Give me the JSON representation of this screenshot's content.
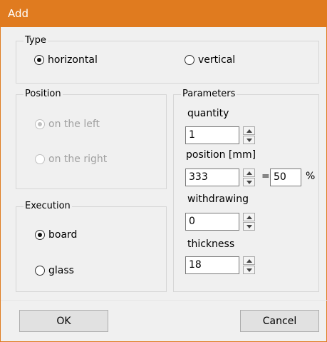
{
  "window": {
    "title": "Add"
  },
  "type_group": {
    "legend": "Type",
    "options": [
      {
        "label": "horizontal",
        "checked": true
      },
      {
        "label": "vertical",
        "checked": false
      }
    ]
  },
  "position_group": {
    "legend": "Position",
    "options": [
      {
        "label": "on the left",
        "checked": true,
        "disabled": true
      },
      {
        "label": "on the right",
        "checked": false,
        "disabled": true
      }
    ]
  },
  "execution_group": {
    "legend": "Execution",
    "options": [
      {
        "label": "board",
        "checked": true
      },
      {
        "label": "glass",
        "checked": false
      }
    ]
  },
  "parameters": {
    "legend": "Parameters",
    "quantity": {
      "label": "quantity",
      "value": "1"
    },
    "position": {
      "label": "position [mm]",
      "value": "333",
      "equals": "=",
      "percent_value": "50",
      "percent_unit": "%"
    },
    "withdrawing": {
      "label": "withdrawing",
      "value": "0"
    },
    "thickness": {
      "label": "thickness",
      "value": "18"
    }
  },
  "buttons": {
    "ok": "OK",
    "cancel": "Cancel"
  }
}
